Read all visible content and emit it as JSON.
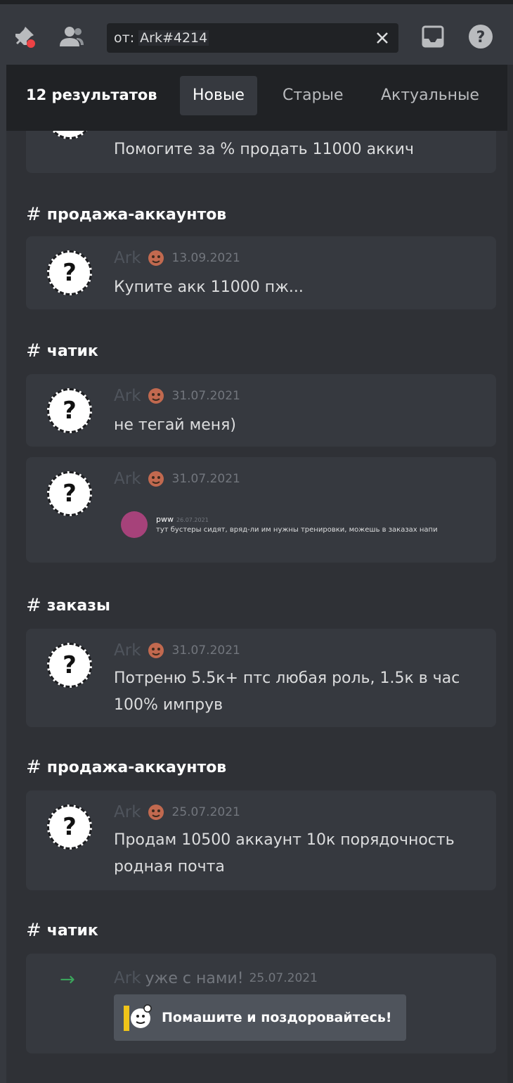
{
  "toolbar": {
    "icons": [
      "pin-icon",
      "members-icon",
      "inbox-icon",
      "help-icon"
    ],
    "search_prefix": "от:",
    "search_value": "Ark#4214"
  },
  "results": {
    "count_label": "12 результатов",
    "tabs": [
      "Новые",
      "Старые",
      "Актуальные"
    ],
    "active_tab": "Новые"
  },
  "partial_message": {
    "text": "Помогите за % продать 11000 аккич"
  },
  "groups": [
    {
      "channel": "продажа-аккаунтов",
      "messages": [
        {
          "author": "Ark",
          "date": "13.09.2021",
          "text": "Купите акк 11000 пж..."
        }
      ]
    },
    {
      "channel": "чатик",
      "messages": [
        {
          "author": "Ark",
          "date": "31.07.2021",
          "text": "не тегай меня)"
        },
        {
          "author": "Ark",
          "date": "31.07.2021",
          "reply": {
            "name": "pww",
            "date": "26.07.2021",
            "text": "тут бустеры сидят, вряд-ли им нужны тренировки, можешь в заказах напи"
          }
        }
      ]
    },
    {
      "channel": "заказы",
      "messages": [
        {
          "author": "Ark",
          "date": "31.07.2021",
          "text_lines": [
            "Потреню 5.5к+ птс любая роль, 1.5к в час",
            "100% импрув"
          ]
        }
      ]
    },
    {
      "channel": "продажа-аккаунтов",
      "messages": [
        {
          "author": "Ark",
          "date": "25.07.2021",
          "text_lines": [
            "Продам 10500 аккаунт 10к порядочность",
            "родная почта"
          ]
        }
      ]
    },
    {
      "channel": "чатик",
      "messages": [
        {
          "system": true,
          "author": "Ark",
          "join_text": "уже с нами!",
          "date": "25.07.2021",
          "button_label": "Помашите и поздоровайтесь!"
        }
      ]
    }
  ],
  "colors": {
    "background": "#2f3136",
    "card": "#36393f",
    "header": "#202225",
    "join_arrow": "#3ba55c"
  }
}
